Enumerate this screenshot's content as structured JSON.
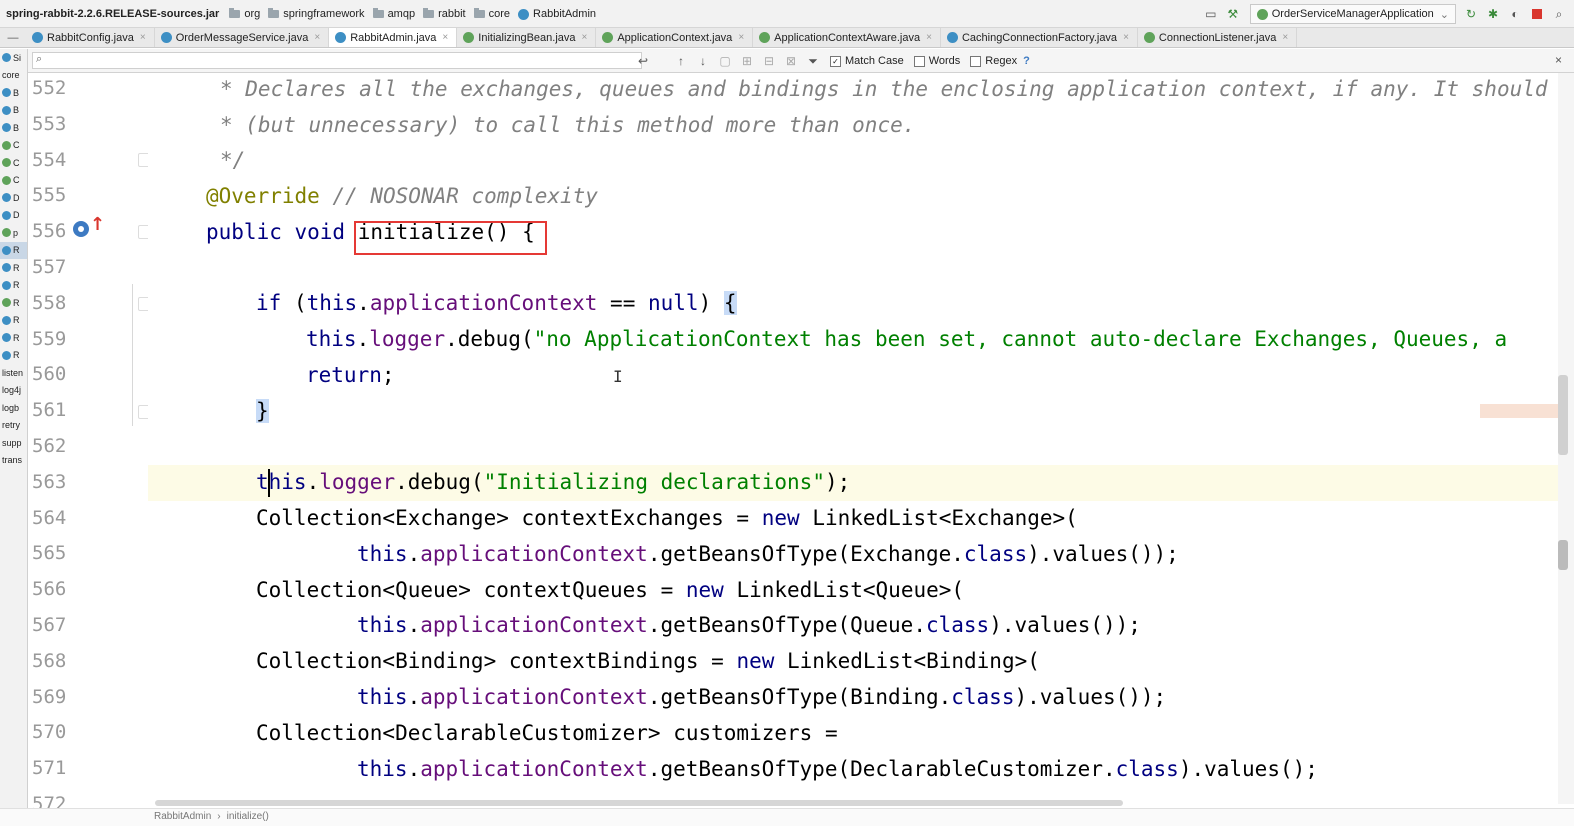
{
  "navbar": {
    "items": [
      {
        "label": "spring-rabbit-2.2.6.RELEASE-sources.jar",
        "kind": "jar"
      },
      {
        "label": "org",
        "kind": "folder"
      },
      {
        "label": "springframework",
        "kind": "folder"
      },
      {
        "label": "amqp",
        "kind": "folder"
      },
      {
        "label": "rabbit",
        "kind": "folder"
      },
      {
        "label": "core",
        "kind": "folder"
      },
      {
        "label": "RabbitAdmin",
        "kind": "class"
      }
    ],
    "run_config": "OrderServiceManagerApplication"
  },
  "tabs": [
    {
      "label": "RabbitConfig.java",
      "kind": "class",
      "active": false
    },
    {
      "label": "OrderMessageService.java",
      "kind": "class",
      "active": false
    },
    {
      "label": "RabbitAdmin.java",
      "kind": "class",
      "active": true
    },
    {
      "label": "InitializingBean.java",
      "kind": "interface",
      "active": false
    },
    {
      "label": "ApplicationContext.java",
      "kind": "interface",
      "active": false
    },
    {
      "label": "ApplicationContextAware.java",
      "kind": "interface",
      "active": false
    },
    {
      "label": "CachingConnectionFactory.java",
      "kind": "class",
      "active": false
    },
    {
      "label": "ConnectionListener.java",
      "kind": "interface",
      "active": false
    }
  ],
  "find": {
    "placeholder": "",
    "match_case": {
      "label": "Match Case",
      "checked": true
    },
    "words": {
      "label": "Words",
      "checked": false
    },
    "regex": {
      "label": "Regex",
      "checked": false
    },
    "help": "?"
  },
  "project_items": [
    "Si",
    "core",
    "B",
    "B",
    "B",
    "C",
    "C",
    "C",
    "D",
    "D",
    "p",
    "R",
    "R",
    "R",
    "R",
    "R",
    "R",
    "R",
    "listen",
    "log4j",
    "logb",
    "retry",
    "supp",
    "trans"
  ],
  "line_numbers": [
    "552",
    "553",
    "554",
    "555",
    "556",
    "557",
    "558",
    "559",
    "560",
    "561",
    "562",
    "563",
    "564",
    "565",
    "566",
    "567",
    "568",
    "569",
    "570",
    "571",
    "572"
  ],
  "code": {
    "l552": "* Declares all the exchanges, queues and bindings in the enclosing application context, if any. It should be",
    "l553": "* (but unnecessary) to call this method more than once.",
    "l554": "*/",
    "l555_ann": "@Override",
    "l555_cmt": " // NOSONAR complexity",
    "l556_kw": "public void",
    "l556_rest": " initialize() {",
    "l558_kw": "if",
    "l558_a": " (",
    "l558_this": "this",
    "l558_b": ".",
    "l558_fld": "applicationContext",
    "l558_c": " == ",
    "l558_null": "null",
    "l558_d": ") ",
    "l558_brace": "{",
    "l559_this": "this",
    "l559_b": ".",
    "l559_fld": "logger",
    "l559_c": ".debug(",
    "l559_str": "\"no ApplicationContext has been set, cannot auto-declare Exchanges, Queues, a",
    "l560_kw": "return",
    "l560_rest": ";",
    "l561_brace": "}",
    "l563_this": "this",
    "l563_b": ".",
    "l563_fld": "logger",
    "l563_c": ".debug(",
    "l563_str": "\"Initializing declarations\"",
    "l563_d": ");",
    "l564_a": "Collection<Exchange> contextExchanges = ",
    "l564_new": "new",
    "l564_b": " LinkedList<Exchange>(",
    "l565_this": "this",
    "l565_b": ".",
    "l565_fld": "applicationContext",
    "l565_c": ".getBeansOfType(Exchange.",
    "l565_cls": "class",
    "l565_d": ").values());",
    "l566_a": "Collection<Queue> contextQueues = ",
    "l566_new": "new",
    "l566_b": " LinkedList<Queue>(",
    "l567_this": "this",
    "l567_b": ".",
    "l567_fld": "applicationContext",
    "l567_c": ".getBeansOfType(Queue.",
    "l567_cls": "class",
    "l567_d": ").values());",
    "l568_a": "Collection<Binding> contextBindings = ",
    "l568_new": "new",
    "l568_b": " LinkedList<Binding>(",
    "l569_this": "this",
    "l569_b": ".",
    "l569_fld": "applicationContext",
    "l569_c": ".getBeansOfType(Binding.",
    "l569_cls": "class",
    "l569_d": ").values());",
    "l570_a": "Collection<DeclarableCustomizer> customizers =",
    "l571_this": "this",
    "l571_b": ".",
    "l571_fld": "applicationContext",
    "l571_c": ".getBeansOfType(DeclarableCustomizer.",
    "l571_cls": "class",
    "l571_d": ").values();"
  },
  "status_breadcrumb": [
    "RabbitAdmin",
    "initialize()"
  ],
  "colors": {
    "keyword": "#000080",
    "field": "#660e7a",
    "string": "#008000",
    "comment": "#808080",
    "annotation": "#808000",
    "highlight_box": "#e53935"
  }
}
